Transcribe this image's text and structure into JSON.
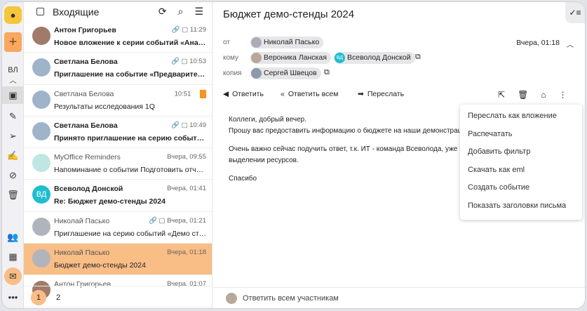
{
  "rail": {
    "user": "ВЛ"
  },
  "list": {
    "title": "Входящие",
    "pages": [
      "1",
      "2"
    ],
    "items": [
      {
        "sender": "Антон Григорьев",
        "time": "11:29",
        "subject": "Новое вложение к серии событий «Аналити...",
        "unread": true,
        "attach": true,
        "avatar": "#a07a6a"
      },
      {
        "sender": "Светлана Белова",
        "time": "10:53",
        "subject": "Приглашение на событие «Предварительно...",
        "unread": true,
        "attach": true,
        "avatar": "#9fb4c8"
      },
      {
        "sender": "Светлана Белова",
        "time": "10:51",
        "subject": "Результаты исследования 1Q",
        "unread": false,
        "flag": true,
        "avatar": "#9fb4c8"
      },
      {
        "sender": "Светлана Белова",
        "time": "10:49",
        "subject": "Принято приглашение на серию событий «...",
        "unread": true,
        "attach": true,
        "avatar": "#9fb4c8"
      },
      {
        "sender": "MyOffice Reminders",
        "time": "Вчера, 09:55",
        "subject": "Напоминание о событии Подготовить отчет...",
        "unread": false,
        "avatar": "#bfe6e2"
      },
      {
        "sender": "Всеволод Донской",
        "time": "Вчера, 01:41",
        "subject": "Re: Бюджет демо-стенды 2024",
        "unread": true,
        "initials": "ВД",
        "avatar": "#1fbdd0"
      },
      {
        "sender": "Николай Пасько",
        "time": "Вчера, 01:21",
        "subject": "Приглашение на серию событий «Демо стен...",
        "unread": false,
        "attach": true,
        "avatar": "#b0b4bc"
      },
      {
        "sender": "Николай Пасько",
        "time": "Вчера, 01:18",
        "subject": "Бюджет демо-стенды 2024",
        "unread": false,
        "selected": true,
        "avatar": "#b0b4bc"
      },
      {
        "sender": "Антон Григорьев",
        "time": "Вчера, 01:07",
        "subject": "",
        "unread": false,
        "avatar": "#a07a6a"
      }
    ]
  },
  "message": {
    "subject": "Бюджет демо-стенды 2024",
    "from_label": "от",
    "to_label": "кому",
    "cc_label": "копия",
    "from": "Николай Пасько",
    "to": [
      "Вероника Ланская",
      "Всеволод Донской"
    ],
    "to_initials": "ВД",
    "cc": "Сергей Швецов",
    "date": "Вчера, 01:18",
    "actions": {
      "reply": "Ответить",
      "reply_all": "Ответить всем",
      "forward": "Переслать"
    },
    "body": [
      "Коллеги, добрый вечер.",
      "Прошу вас предоставить информацию о бюджете на наши демонстраци",
      "Очень важно сейчас подучить ответ, т.к. ИТ - команда Всеволода, уже",
      "выделении ресурсов.",
      "Спасибо"
    ],
    "menu": [
      "Переслать как вложение",
      "Распечатать",
      "Добавить фильтр",
      "Скачать как eml",
      "Создать событие",
      "Показать заголовки письма"
    ],
    "reply_all_placeholder": "Ответить всем участникам"
  },
  "colors": {
    "accent": "#f9bd86",
    "brand": "#f5c63c",
    "flag": "#f7931e"
  }
}
